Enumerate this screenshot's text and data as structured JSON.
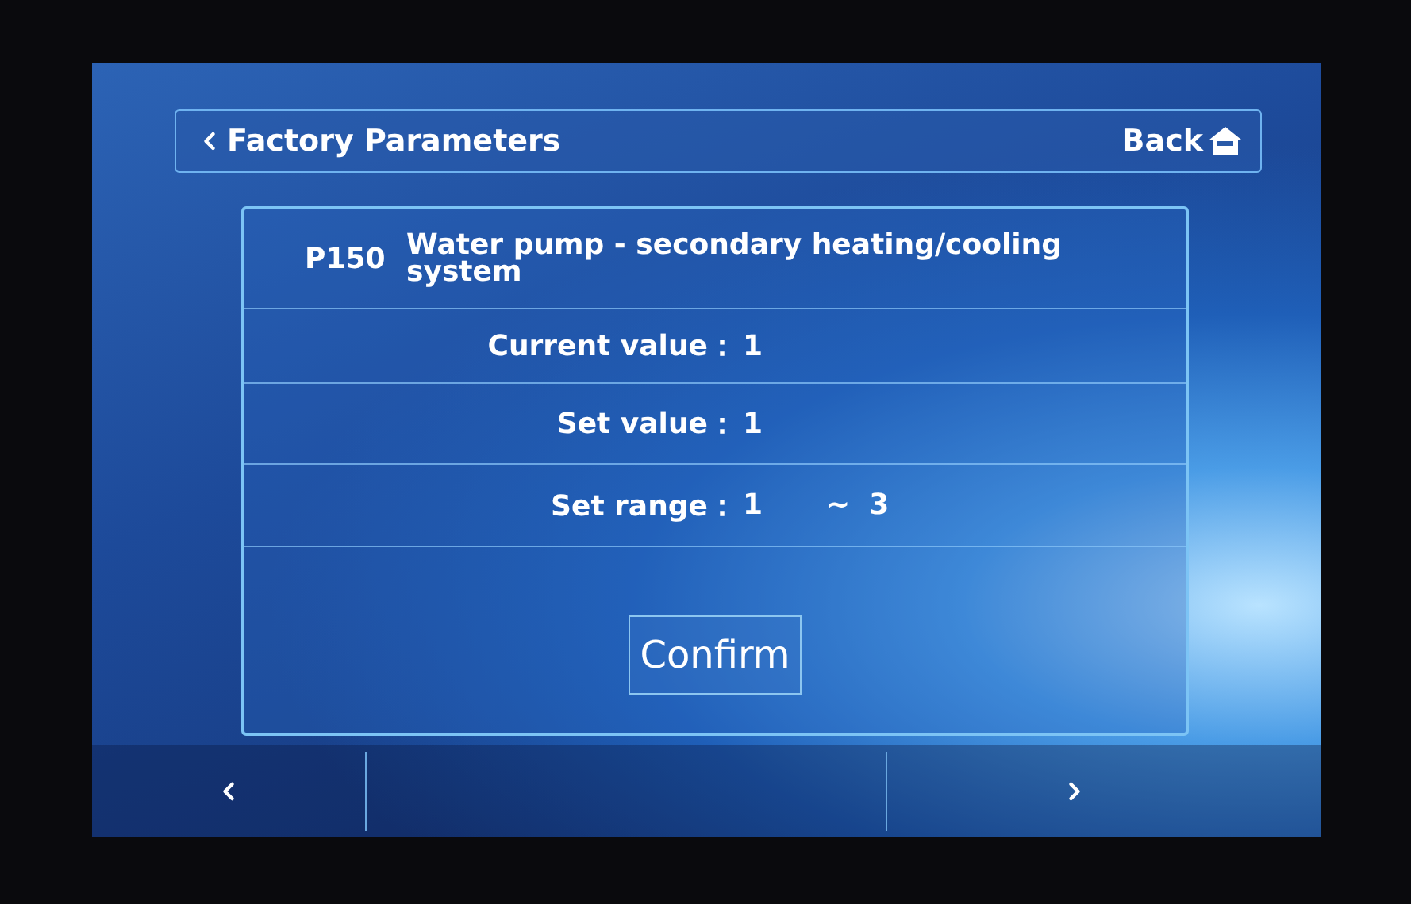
{
  "header": {
    "title": "Factory Parameters",
    "back_label": "Back"
  },
  "parameter": {
    "code": "P150",
    "name": "Water pump - secondary heating/cooling system"
  },
  "fields": [
    {
      "label": "Current value：",
      "value": "1"
    },
    {
      "label": "Set value：",
      "value": "1"
    }
  ],
  "range": {
    "label": "Set range：",
    "min": "1",
    "separator": "~",
    "max": "3"
  },
  "confirm_button": "Confirm"
}
